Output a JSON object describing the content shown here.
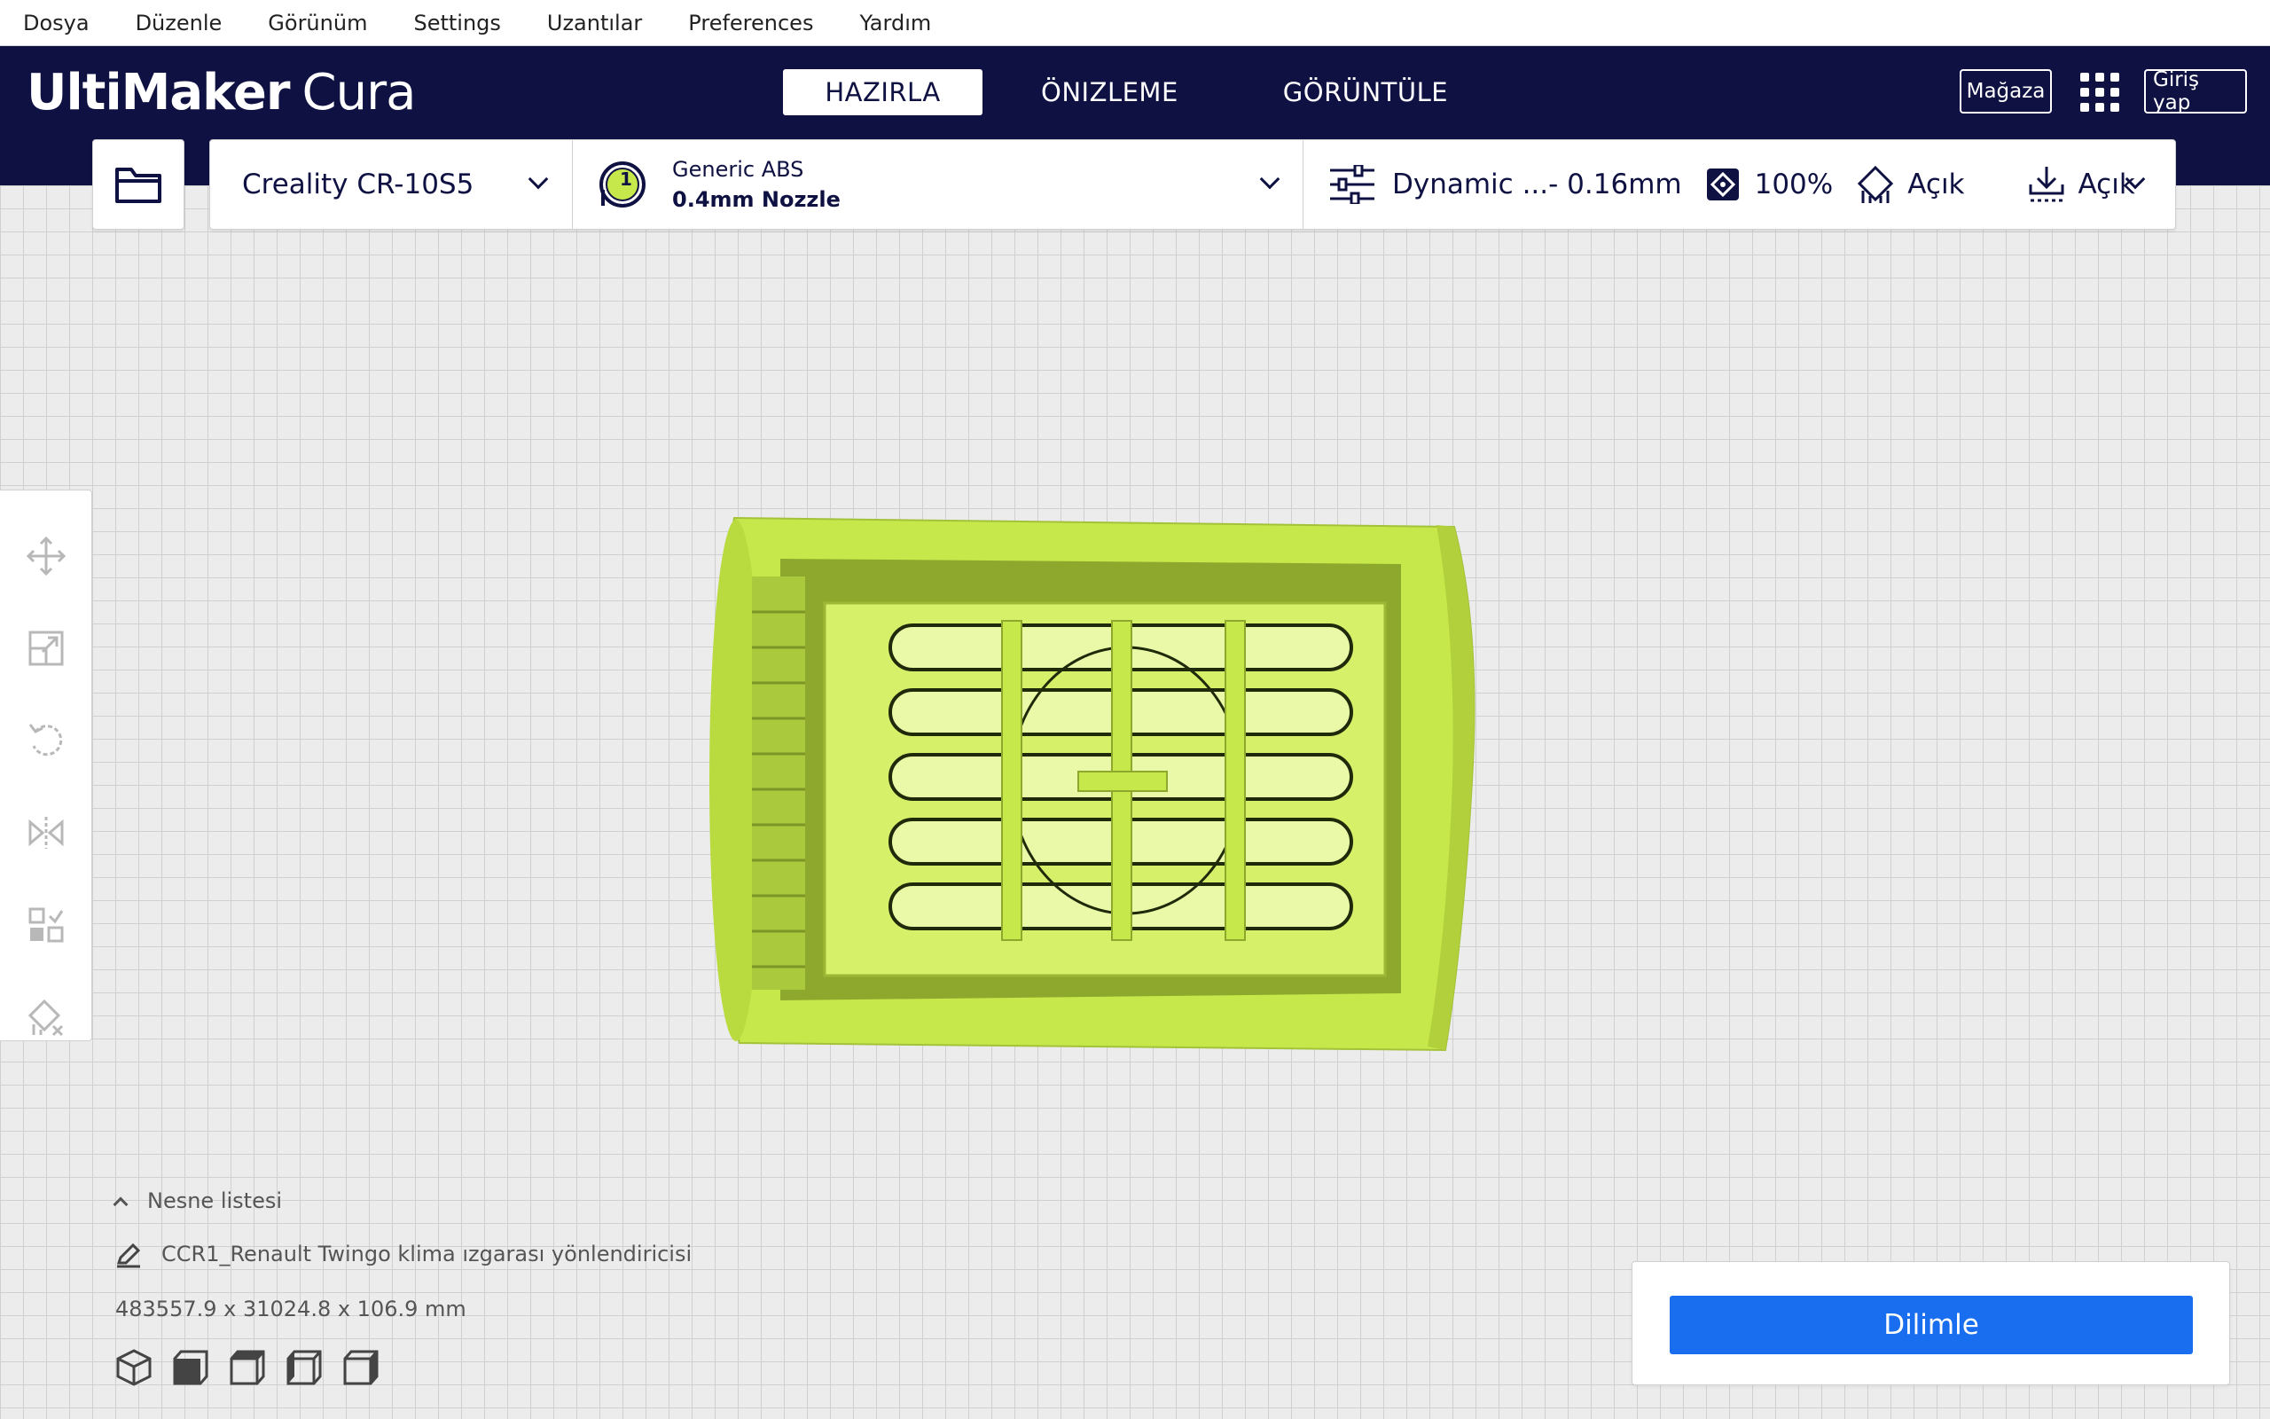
{
  "menu": {
    "items": [
      {
        "label": "Dosya"
      },
      {
        "label": "Düzenle"
      },
      {
        "label": "Görünüm"
      },
      {
        "label": "Settings"
      },
      {
        "label": "Uzantılar"
      },
      {
        "label": "Preferences"
      },
      {
        "label": "Yardım"
      }
    ]
  },
  "header": {
    "logo_bold": "UltiMaker",
    "logo_light": "Cura",
    "tabs": [
      {
        "label": "HAZIRLA",
        "active": true
      },
      {
        "label": "ÖNIZLEME",
        "active": false
      },
      {
        "label": "GÖRÜNTÜLE",
        "active": false
      }
    ],
    "marketplace": "Mağaza",
    "signin": "Giriş yap"
  },
  "toolbar": {
    "printer": "Creality CR-10S5",
    "extruder_number": "1",
    "material": "Generic ABS",
    "nozzle": "0.4mm Nozzle",
    "profile": "Dynamic ...- 0.16mm",
    "infill": "100%",
    "support": "Açık",
    "adhesion": "Açık"
  },
  "object_list": {
    "header": "Nesne listesi",
    "object_name": "CCR1_Renault Twingo klima ızgarası yönlendiricisi",
    "dimensions": "483557.9 x 31024.8 x 106.9 mm"
  },
  "slice": {
    "button": "Dilimle"
  },
  "colors": {
    "navy": "#0e1142",
    "accent_blue": "#196ef0",
    "model_green": "#c6e84a"
  }
}
